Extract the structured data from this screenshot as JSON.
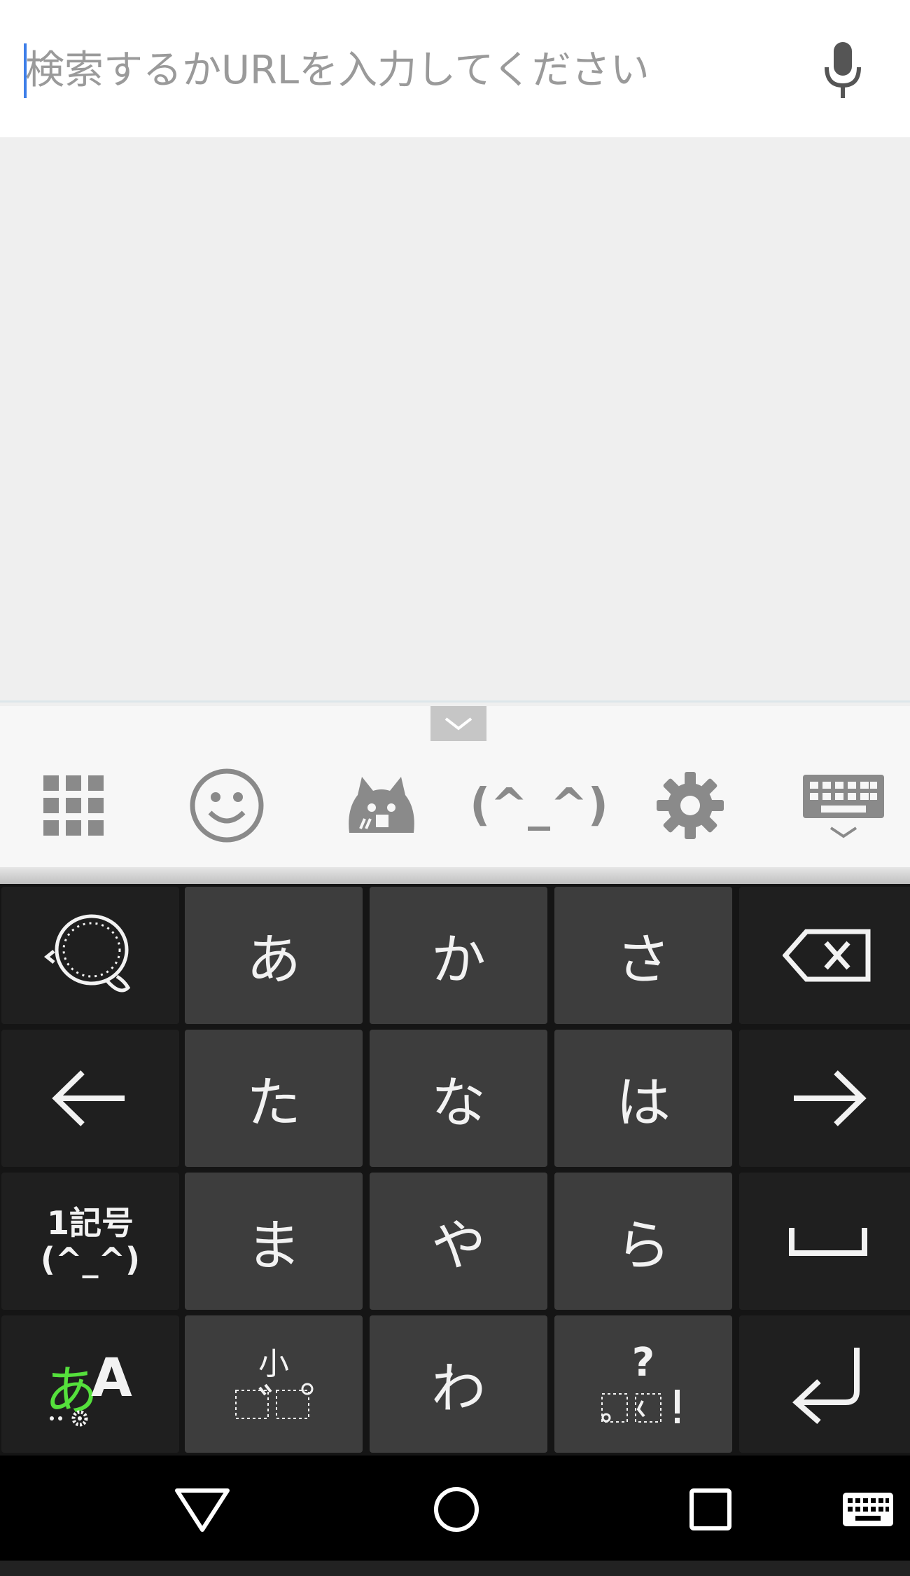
{
  "search": {
    "placeholder": "検索するかURLを入力してください",
    "caret_color": "#3d7ee8"
  },
  "icons": {
    "mic": "microphone-icon",
    "collapse": "chevron-down-icon"
  },
  "ime_toolbar": {
    "items": [
      {
        "name": "apps-grid-icon"
      },
      {
        "name": "emoji-smiley-icon"
      },
      {
        "name": "cat-face-icon"
      },
      {
        "name": "kaomoji",
        "label": "(^_^)"
      },
      {
        "name": "settings-gear-icon"
      },
      {
        "name": "hide-keyboard-icon"
      }
    ]
  },
  "keyboard": {
    "rows": [
      [
        {
          "type": "icon",
          "name": "voice-bubble-icon"
        },
        {
          "label": "あ"
        },
        {
          "label": "か"
        },
        {
          "label": "さ"
        },
        {
          "type": "icon",
          "name": "backspace-icon"
        }
      ],
      [
        {
          "type": "icon",
          "name": "arrow-left-icon"
        },
        {
          "label": "た"
        },
        {
          "label": "な"
        },
        {
          "label": "は"
        },
        {
          "type": "icon",
          "name": "arrow-right-icon"
        }
      ],
      [
        {
          "label": "1記号\n(^_^)"
        },
        {
          "label": "ま"
        },
        {
          "label": "や"
        },
        {
          "label": "ら"
        },
        {
          "type": "icon",
          "name": "space-icon"
        }
      ],
      [
        {
          "label_hira": "あ",
          "label_latin": "A"
        },
        {
          "label": "小"
        },
        {
          "label": "わ"
        },
        {
          "label": "?"
        },
        {
          "type": "icon",
          "name": "enter-icon"
        }
      ]
    ],
    "mode_accent_color": "#55e03c"
  },
  "system_nav": {
    "buttons": [
      "back-icon",
      "home-icon",
      "recents-icon",
      "keyboard-switch-icon"
    ]
  }
}
